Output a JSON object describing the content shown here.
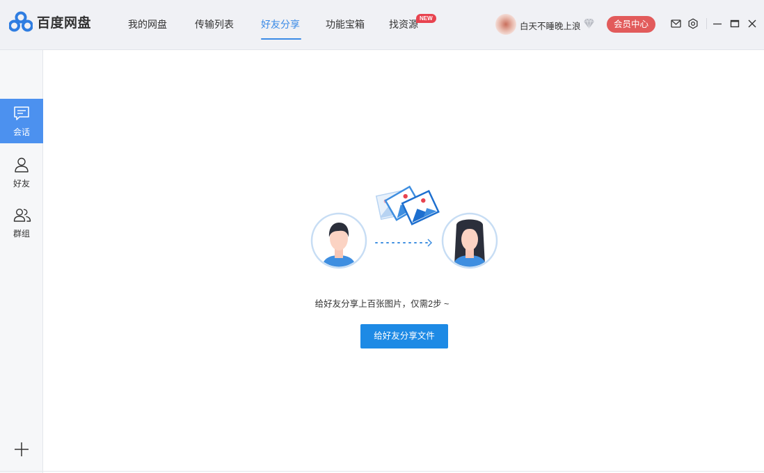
{
  "app": {
    "name": "百度网盘"
  },
  "nav": {
    "items": [
      "我的网盘",
      "传输列表",
      "好友分享",
      "功能宝箱",
      "找资源"
    ],
    "active": "好友分享",
    "new_badge": "NEW"
  },
  "user": {
    "name": "白天不睡晚上浪",
    "vip_button": "会员中心"
  },
  "sidebar": {
    "items": [
      {
        "label": "会话",
        "icon": "chat-icon",
        "active": true
      },
      {
        "label": "好友",
        "icon": "person-icon",
        "active": false
      },
      {
        "label": "群组",
        "icon": "group-icon",
        "active": false
      }
    ]
  },
  "main": {
    "hint": "给好友分享上百张图片，仅需2步 ~",
    "share_button": "给好友分享文件"
  },
  "colors": {
    "accent": "#3a8ae6",
    "vip": "#e25b5b",
    "button": "#1d8ae5",
    "sidebar_active": "#4c91ef"
  }
}
